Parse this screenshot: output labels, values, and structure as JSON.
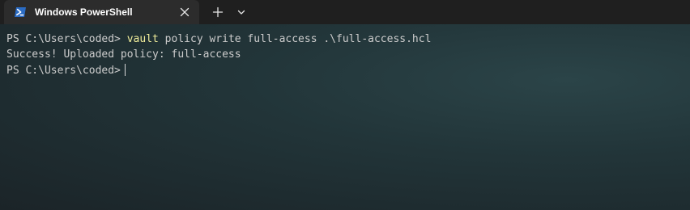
{
  "tab": {
    "title": "Windows PowerShell",
    "icon": "powershell-icon",
    "close_icon": "close-icon"
  },
  "toolbar": {
    "new_tab_icon": "plus-icon",
    "dropdown_icon": "chevron-down-icon"
  },
  "terminal": {
    "lines": [
      {
        "prompt": "PS C:\\Users\\coded> ",
        "command": "vault",
        "args": " policy write full-access .\\full-access.hcl"
      },
      {
        "output": "Success! Uploaded policy: full-access"
      },
      {
        "prompt": "PS C:\\Users\\coded>"
      }
    ]
  },
  "colors": {
    "tabbar_bg": "#1f1f1f",
    "active_tab_bg": "#2c2c2c",
    "terminal_text": "#cccccc",
    "command_highlight": "#f0ec9a",
    "powershell_icon_bg": "#2b6cc4"
  }
}
